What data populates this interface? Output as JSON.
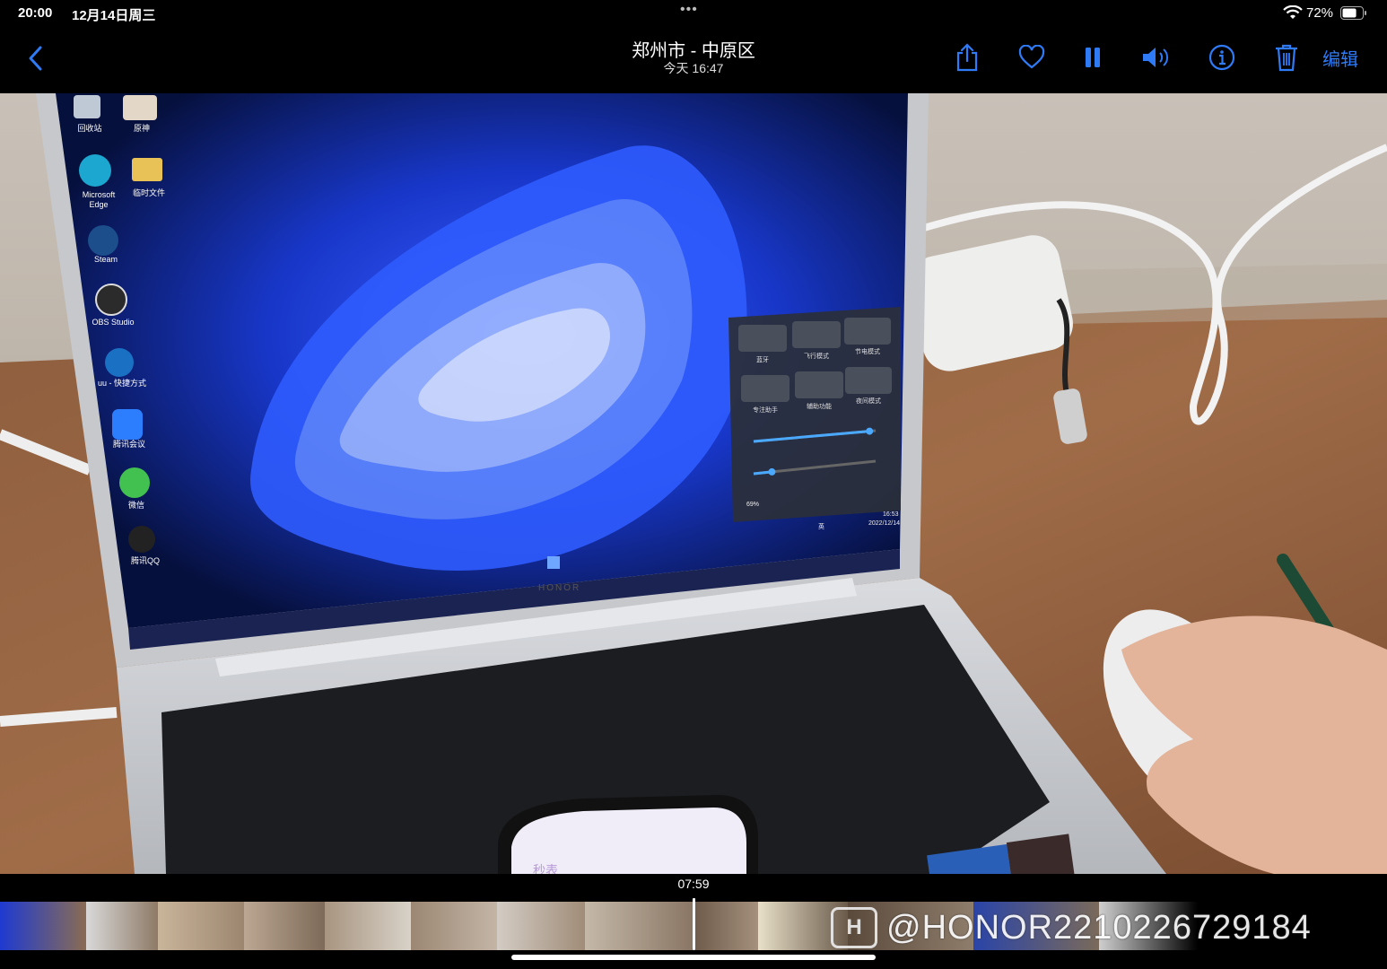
{
  "status_bar": {
    "time": "20:00",
    "date": "12月14日周三",
    "battery_percent": "72%",
    "battery_level": 0.72
  },
  "nav": {
    "location_title": "郑州市 - 中原区",
    "timestamp": "今天  16:47",
    "edit_label": "编辑",
    "icons": [
      "share-icon",
      "heart-icon",
      "pause-icon",
      "volume-icon",
      "info-icon",
      "trash-icon"
    ],
    "accent_color": "#2f7bf6"
  },
  "photo": {
    "desktop_icons": [
      {
        "label": "回收站"
      },
      {
        "label": "原神"
      },
      {
        "label": "Microsoft Edge"
      },
      {
        "label": "临时文件"
      },
      {
        "label": "Steam"
      },
      {
        "label": "OBS Studio"
      },
      {
        "label": "uu - 快捷方式"
      },
      {
        "label": "腾讯会议"
      },
      {
        "label": "微信"
      },
      {
        "label": "腾讯QQ"
      }
    ],
    "quick_settings": {
      "tiles": [
        "蓝牙",
        "飞行模式",
        "节电模式",
        "专注助手",
        "辅助功能",
        "夜间模式"
      ],
      "battery": "69%",
      "brightness_level": 0.95,
      "volume_level": 0.15
    },
    "taskbar": {
      "ime": "英",
      "clock_time": "16:53",
      "clock_date": "2022/12/14"
    },
    "laptop_brand": "HONOR",
    "phone_text": "秒表"
  },
  "scrubber": {
    "current_time": "07:59",
    "watermark": "@HONOR2210226729184"
  }
}
